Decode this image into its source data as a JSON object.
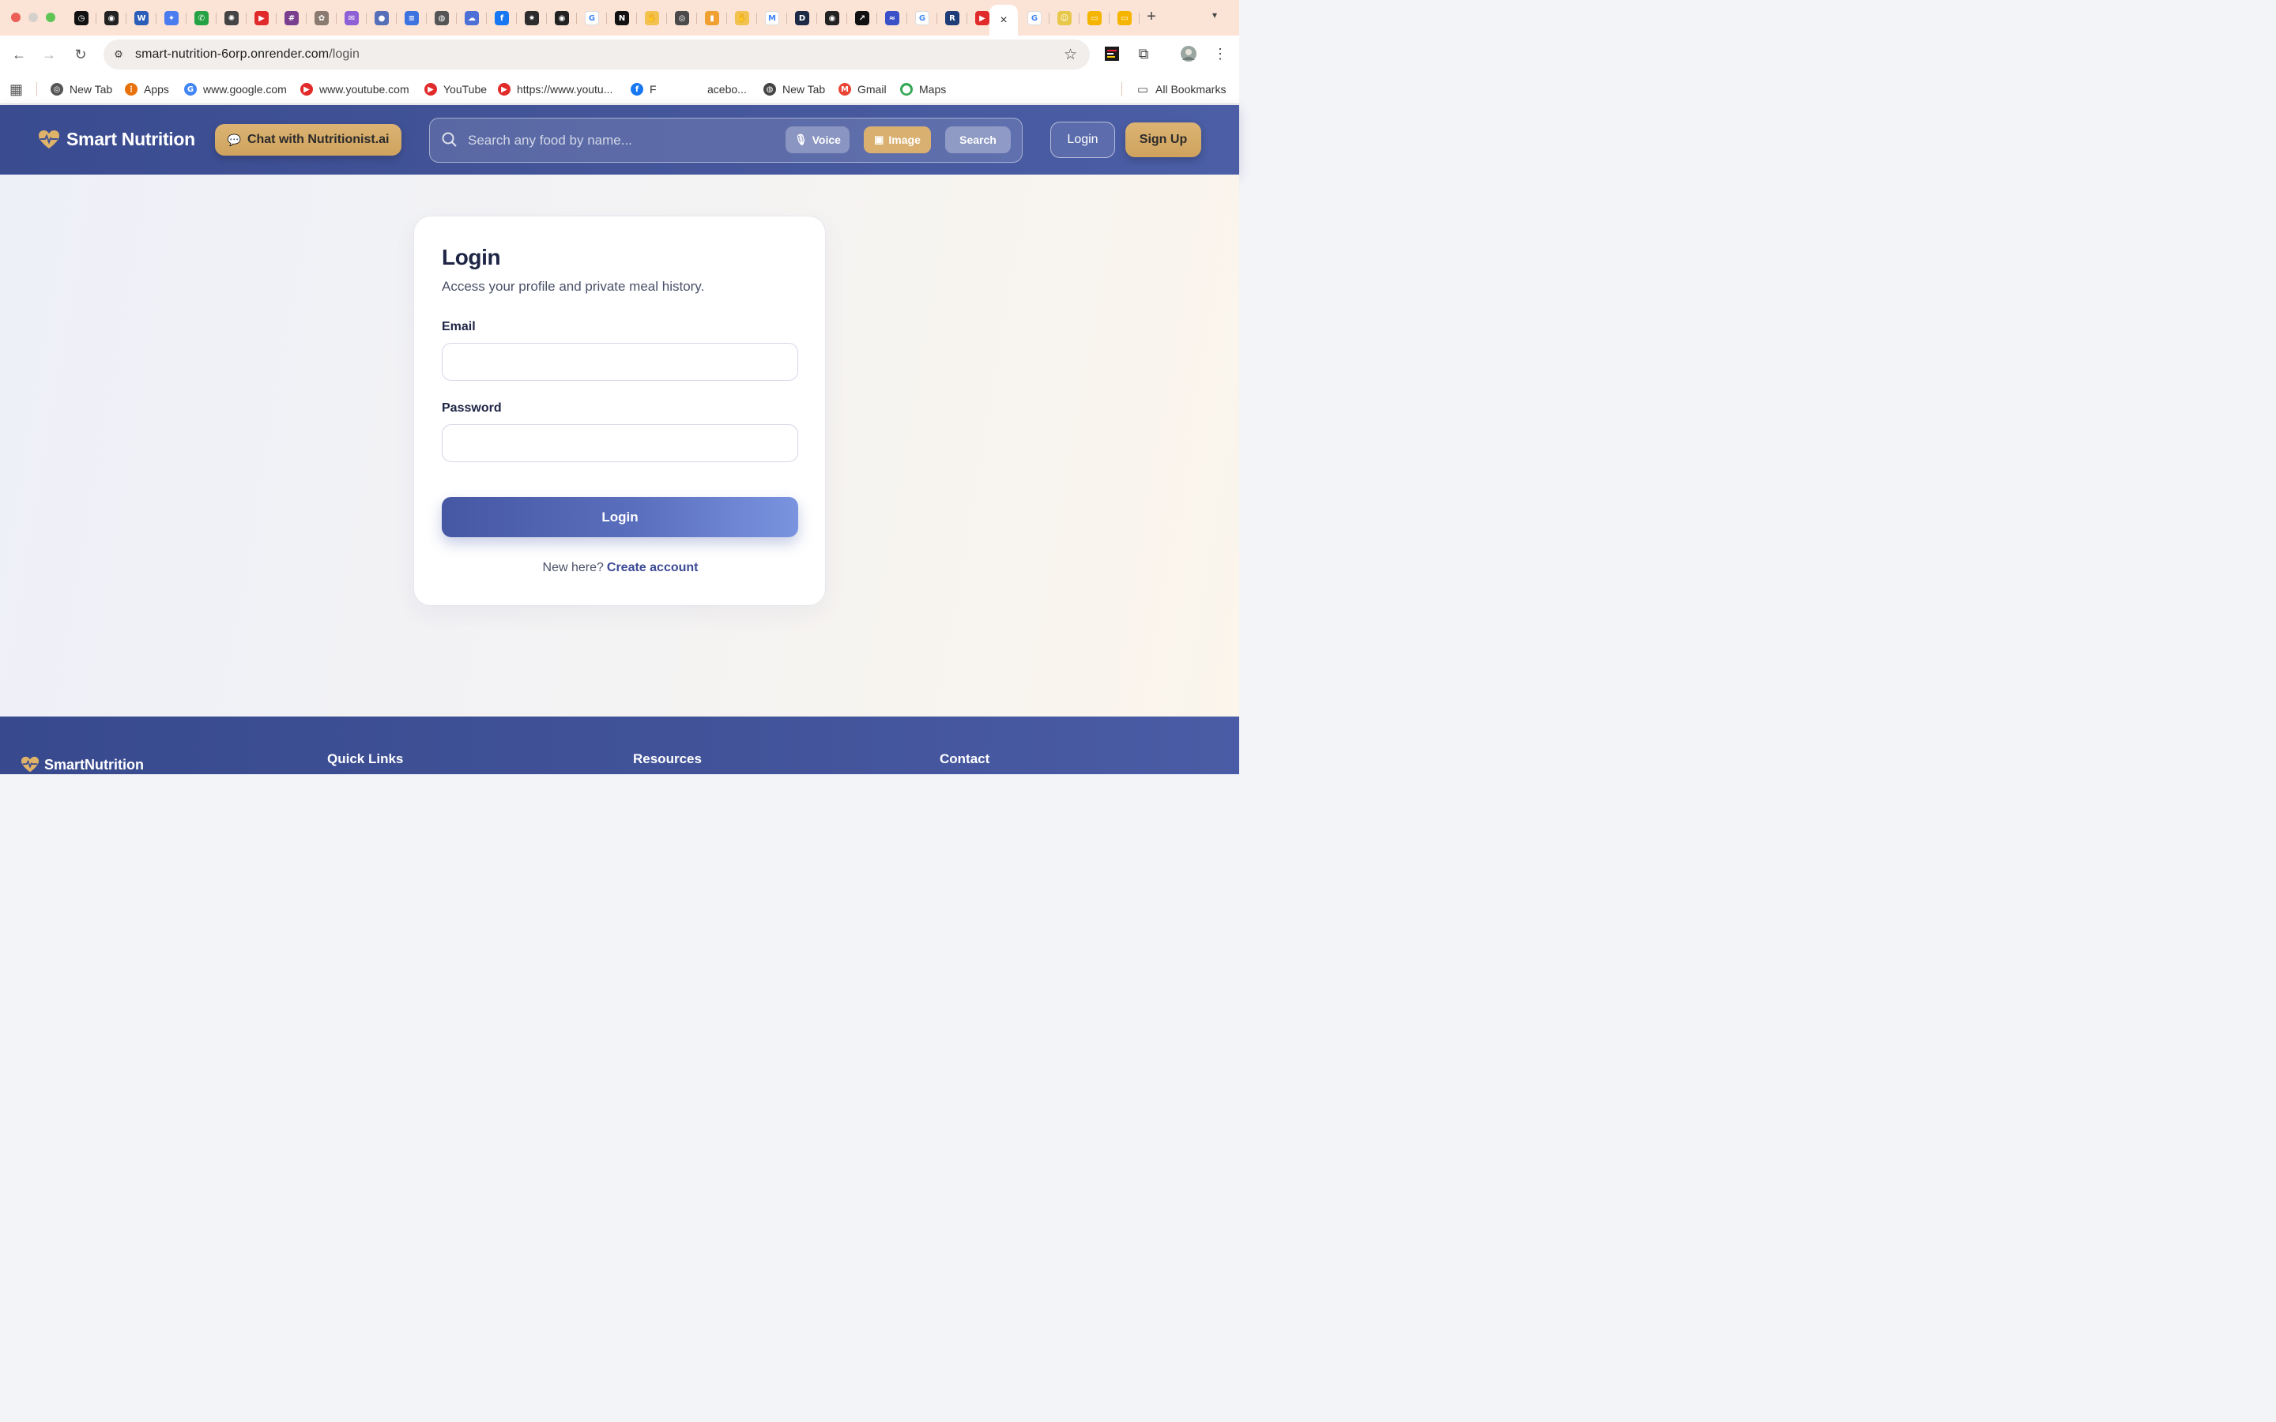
{
  "browser": {
    "tab_favicons": [
      {
        "icon": "clock-icon",
        "bg": "#111111",
        "glyph": "◷"
      },
      {
        "icon": "github-icon",
        "bg": "#222222",
        "glyph": "◉"
      },
      {
        "icon": "word-icon",
        "bg": "#2b5eb8",
        "glyph": "W"
      },
      {
        "icon": "gemini-icon",
        "bg": "#4a7cf0",
        "glyph": "✦"
      },
      {
        "icon": "whatsapp-icon",
        "bg": "#25a244",
        "glyph": "✆"
      },
      {
        "icon": "openai-icon",
        "bg": "#444444",
        "glyph": "✺"
      },
      {
        "icon": "youtube-icon",
        "bg": "#e12b2b",
        "glyph": "▶"
      },
      {
        "icon": "slack-icon",
        "bg": "#7a3e8e",
        "glyph": "#"
      },
      {
        "icon": "brain-icon",
        "bg": "#8a7a70",
        "glyph": "✿"
      },
      {
        "icon": "mail-icon",
        "bg": "#8f5fd6",
        "glyph": "✉"
      },
      {
        "icon": "circle-logo-icon",
        "bg": "#5570b8",
        "glyph": "●"
      },
      {
        "icon": "docs-icon",
        "bg": "#3d72e0",
        "glyph": "≡"
      },
      {
        "icon": "globe-icon",
        "bg": "#555555",
        "glyph": "◍"
      },
      {
        "icon": "cloud-icon",
        "bg": "#4d6fd6",
        "glyph": "☁"
      },
      {
        "icon": "facebook-icon",
        "bg": "#1877f2",
        "glyph": "f"
      },
      {
        "icon": "spark-icon",
        "bg": "#2d2d2d",
        "glyph": "✷"
      },
      {
        "icon": "github-icon",
        "bg": "#222222",
        "glyph": "◉"
      },
      {
        "icon": "google-icon",
        "bg": "#ffffff",
        "glyph": "G"
      },
      {
        "icon": "notion-icon",
        "bg": "#111111",
        "glyph": "N"
      },
      {
        "icon": "hand-icon",
        "bg": "#f2c14e",
        "glyph": "✋"
      },
      {
        "icon": "chrome-icon",
        "bg": "#4a4a4a",
        "glyph": "◎"
      },
      {
        "icon": "bar-chart-icon",
        "bg": "#f0a030",
        "glyph": "▮"
      },
      {
        "icon": "hand-icon",
        "bg": "#f2c14e",
        "glyph": "✋"
      },
      {
        "icon": "gmail-icon",
        "bg": "#ffffff",
        "glyph": "M"
      },
      {
        "icon": "d-logo-icon",
        "bg": "#1d2a45",
        "glyph": "D"
      },
      {
        "icon": "github-icon",
        "bg": "#222222",
        "glyph": "◉"
      },
      {
        "icon": "arrow-box-icon",
        "bg": "#111111",
        "glyph": "↗"
      },
      {
        "icon": "wave-icon",
        "bg": "#3a50c8",
        "glyph": "≈"
      },
      {
        "icon": "google-icon",
        "bg": "#ffffff",
        "glyph": "G"
      },
      {
        "icon": "r-logo-icon",
        "bg": "#1e3c78",
        "glyph": "R"
      },
      {
        "icon": "youtube-icon",
        "bg": "#e12b2b",
        "glyph": "▶"
      }
    ],
    "tab_favicons_after": [
      {
        "icon": "google-icon",
        "bg": "#ffffff",
        "glyph": "G"
      },
      {
        "icon": "smile-icon",
        "bg": "#e8c84a",
        "glyph": "☺"
      },
      {
        "icon": "slides-icon",
        "bg": "#f4b400",
        "glyph": "▭"
      },
      {
        "icon": "slides-icon",
        "bg": "#f4b400",
        "glyph": "▭"
      }
    ],
    "active_tab_close": "×",
    "url_host": "smart-nutrition-6orp.onrender.com",
    "url_path": "/login",
    "bookmarks": [
      {
        "label": "New Tab",
        "icon": "chrome-icon",
        "color": "#555555",
        "glyph": "◎"
      },
      {
        "label": "Apps",
        "icon": "apps-grid-icon",
        "color": "#e8710a",
        "glyph": "⋮"
      },
      {
        "label": "www.google.com",
        "icon": "google-icon",
        "color": "#4285f4",
        "glyph": "G"
      },
      {
        "label": "www.youtube.com",
        "icon": "youtube-icon",
        "color": "#e12b2b",
        "glyph": "▶"
      },
      {
        "label": "YouTube",
        "icon": "youtube-icon",
        "color": "#e12b2b",
        "glyph": "▶"
      },
      {
        "label": "https://www.youtu...",
        "icon": "youtube-icon",
        "color": "#e12b2b",
        "glyph": "▶"
      },
      {
        "label": "F",
        "icon": "facebook-icon",
        "color": "#1877f2",
        "glyph": "f"
      },
      {
        "label": "acebo...",
        "icon": "",
        "color": "",
        "glyph": ""
      },
      {
        "label": "New Tab",
        "icon": "globe-icon",
        "color": "#444444",
        "glyph": "◍"
      },
      {
        "label": "Gmail",
        "icon": "gmail-icon",
        "color": "#ea4335",
        "glyph": "M"
      },
      {
        "label": "Maps",
        "icon": "maps-pin-icon",
        "color": "#34a853",
        "glyph": "⬤"
      }
    ],
    "all_bookmarks": "All Bookmarks"
  },
  "header": {
    "brand": "Smart Nutrition",
    "chat_label": "Chat with Nutritionist.ai",
    "search_placeholder": "Search any food by name...",
    "voice_label": "Voice",
    "image_label": "Image",
    "search_label": "Search",
    "login_label": "Login",
    "signup_label": "Sign Up"
  },
  "login_card": {
    "title": "Login",
    "subtitle": "Access your profile and private meal history.",
    "email_label": "Email",
    "email_value": "",
    "password_label": "Password",
    "password_value": "",
    "submit_label": "Login",
    "new_here": "New here?",
    "create_account": "Create account"
  },
  "footer": {
    "brand": "SmartNutrition",
    "quick_links": "Quick Links",
    "resources": "Resources",
    "contact": "Contact"
  },
  "colors": {
    "header_bg": "#3f5096",
    "gold_accent": "#d7ad6b",
    "primary_button": "#4a5ba8",
    "link": "#3b4a94"
  }
}
